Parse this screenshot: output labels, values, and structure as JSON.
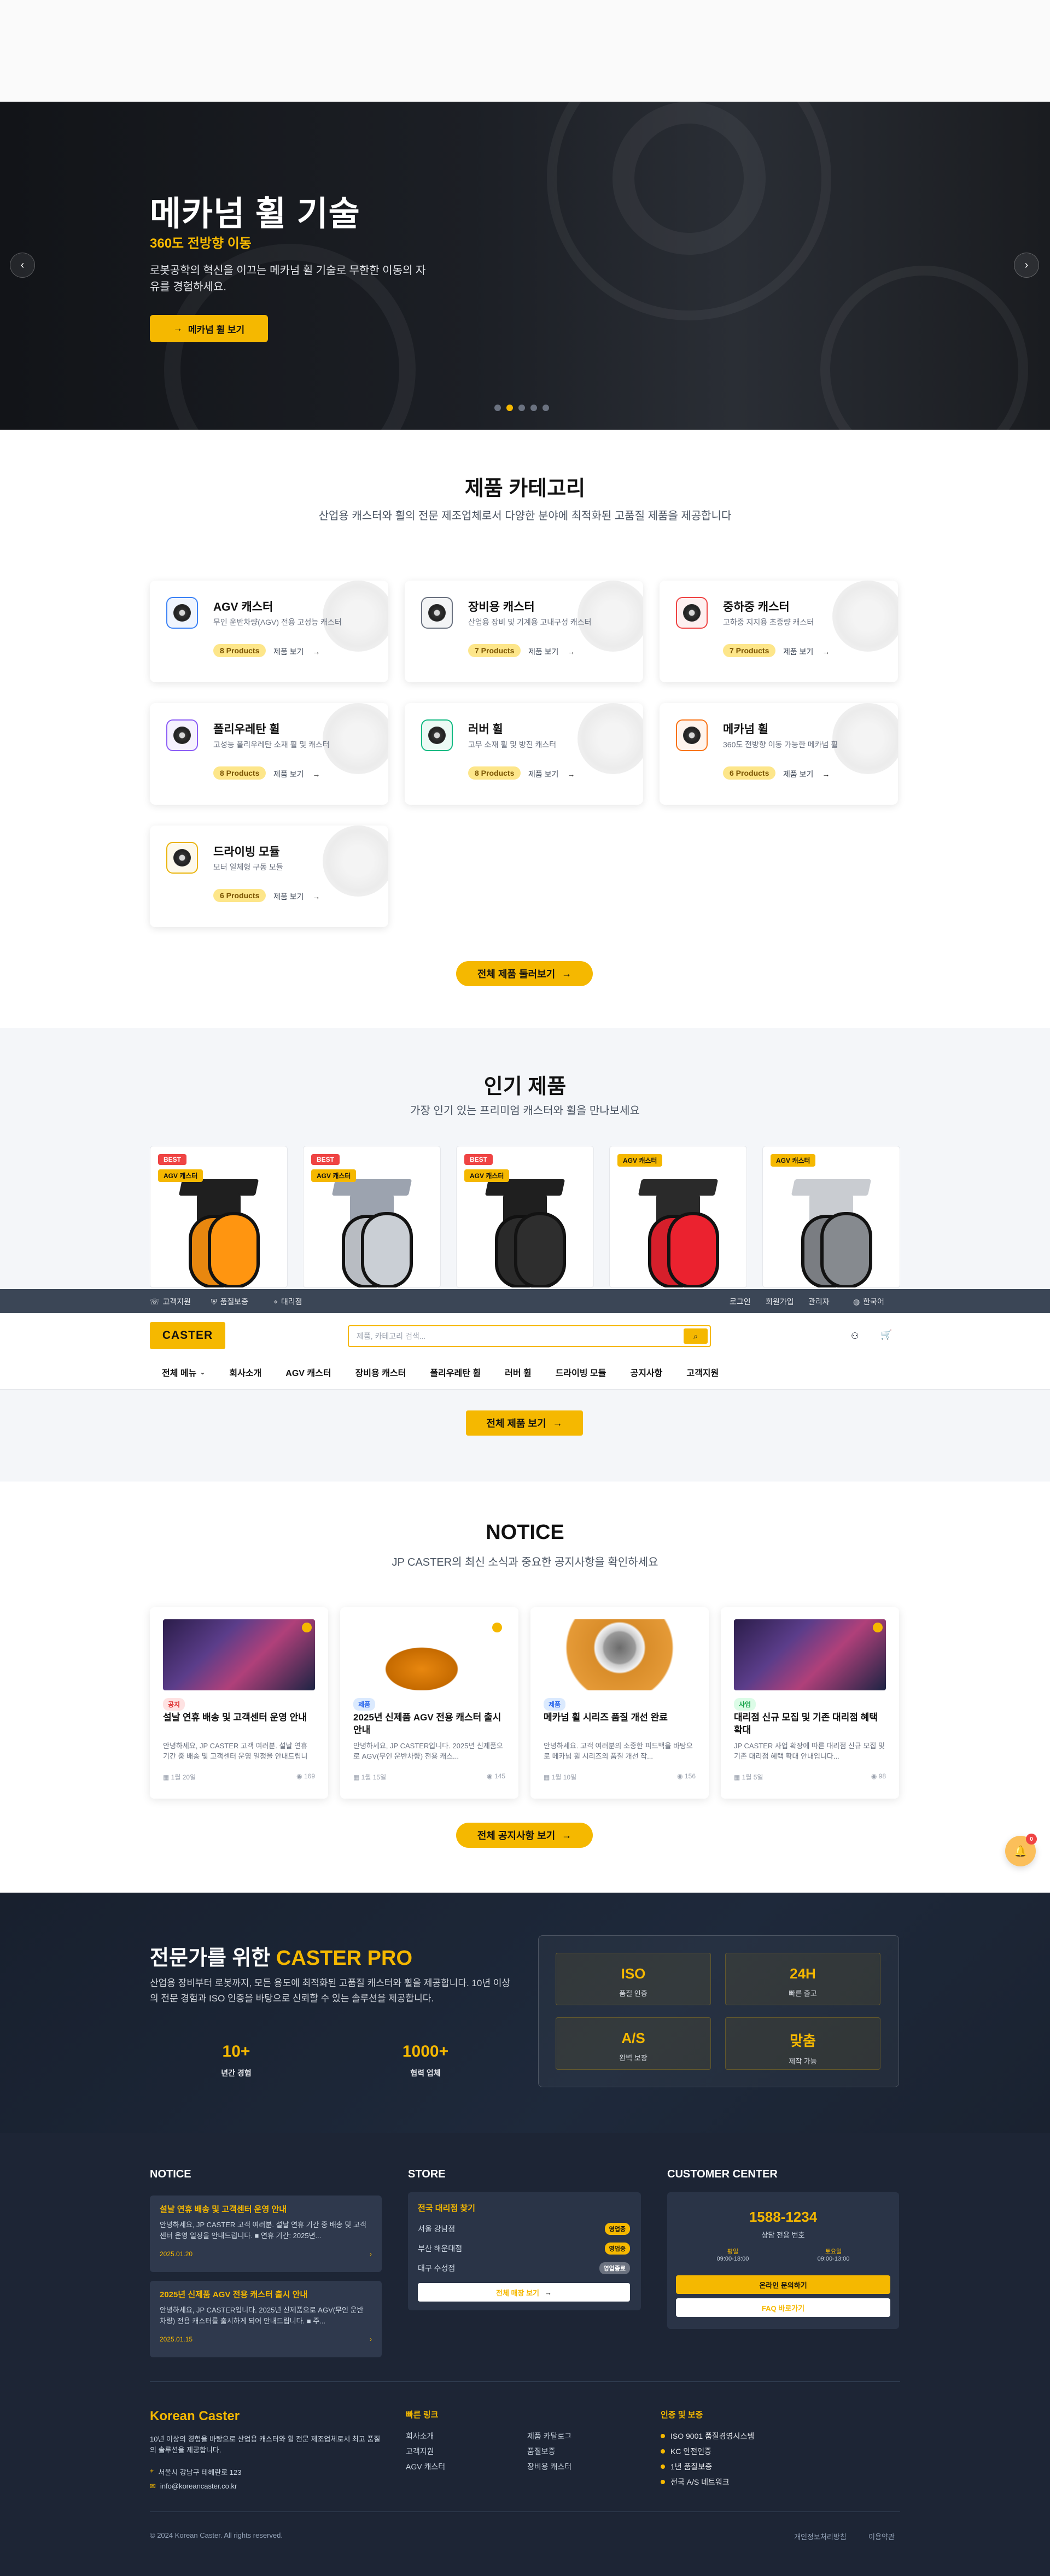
{
  "hero": {
    "title": "메카넘 휠 기술",
    "subtitle": "360도 전방향 이동",
    "desc": "로봇공학의 혁신을 이끄는 메카넘 휠 기술로 무한한 이동의 자유를 경험하세요.",
    "button": "메카넘 휠 보기",
    "prev_icon": "chevron-left-icon",
    "next_icon": "chevron-right-icon",
    "slides": 5,
    "active_slide": 2
  },
  "categories": {
    "title": "제품 카테고리",
    "desc": "산업용 캐스터와 휠의 전문 제조업체로서 다양한 분야에 최적화된 고품질 제품을 제공합니다",
    "items": [
      {
        "name": "AGV 캐스터",
        "desc": "무인 운반차량(AGV) 전용 고성능 캐스터",
        "count": "8 Products",
        "more": "제품 보기",
        "color": "#3b82f6"
      },
      {
        "name": "장비용 캐스터",
        "desc": "산업용 장비 및 기계용 고내구성 캐스터",
        "count": "7 Products",
        "more": "제품 보기",
        "color": "#6b7280"
      },
      {
        "name": "중하중 캐스터",
        "desc": "고하중 지지용 초중량 캐스터",
        "count": "7 Products",
        "more": "제품 보기",
        "color": "#ef4444"
      },
      {
        "name": "폴리우레탄 휠",
        "desc": "고성능 폴리우레탄 소재 휠 및 캐스터",
        "count": "8 Products",
        "more": "제품 보기",
        "color": "#8b5cf6"
      },
      {
        "name": "러버 휠",
        "desc": "고무 소재 휠 및 방진 캐스터",
        "count": "8 Products",
        "more": "제품 보기",
        "color": "#10b981"
      },
      {
        "name": "메카넘 휠",
        "desc": "360도 전방향 이동 가능한 메카넘 휠",
        "count": "6 Products",
        "more": "제품 보기",
        "color": "#f97316"
      },
      {
        "name": "드라이빙 모듈",
        "desc": "모터 일체형 구동 모듈",
        "count": "6 Products",
        "more": "제품 보기",
        "color": "#eab308"
      }
    ],
    "all_button": "전체 제품 둘러보기"
  },
  "popular": {
    "title": "인기 제품",
    "desc": "가장 인기 있는 프리미엄 캐스터와 휠을 만나보세요",
    "items": [
      {
        "best": "BEST",
        "cat": "AGV 캐스터",
        "wheel": "#e8870f",
        "top": "#1f1f1f"
      },
      {
        "best": "BEST",
        "cat": "AGV 캐스터",
        "wheel": "#b8bcc2",
        "top": "#9ca3af"
      },
      {
        "best": "BEST",
        "cat": "AGV 캐스터",
        "wheel": "#2a2a2a",
        "top": "#1f1f1f"
      },
      {
        "best": "",
        "cat": "AGV 캐스터",
        "wheel": "#d61f2b",
        "top": "#2a2a2a"
      },
      {
        "best": "",
        "cat": "AGV 캐스터",
        "wheel": "#7a7d82",
        "top": "#c9ccd1"
      }
    ],
    "all_button": "전체 제품 보기"
  },
  "util": {
    "left": [
      "고객지원",
      "품질보증",
      "대리점"
    ],
    "right": [
      "로그인",
      "회원가입",
      "관리자",
      "한국어"
    ]
  },
  "header": {
    "logo": "CASTER",
    "search_placeholder": "제품, 카테고리 검색...",
    "nav": [
      "전체 메뉴",
      "회사소개",
      "AGV 캐스터",
      "장비용 캐스터",
      "폴리우레탄 휠",
      "러버 휠",
      "드라이빙 모듈",
      "공지사항",
      "고객지원"
    ]
  },
  "notice": {
    "title": "NOTICE",
    "desc": "JP CASTER의 최신 소식과 중요한 공지사항을 확인하세요",
    "items": [
      {
        "tag": "공지",
        "tag_color": "#fee2e2",
        "tag_text": "#dc2626",
        "title": "설날 연휴 배송 및 고객센터 운영 안내",
        "body": "안녕하세요, JP CASTER 고객 여러분. 설날 연휴 기간 중 배송 및 고객센터 운영 일정을 안내드립니다.",
        "date": "1월 20일",
        "views": "169",
        "img": "photo"
      },
      {
        "tag": "제품",
        "tag_color": "#dbeafe",
        "tag_text": "#2563eb",
        "title": "2025년 신제품 AGV 전용 캐스터 출시 안내",
        "body": "안녕하세요, JP CASTER입니다. 2025년 신제품으로 AGV(무인 운반차량) 전용 캐스...",
        "date": "1월 15일",
        "views": "145",
        "img": "caster"
      },
      {
        "tag": "제품",
        "tag_color": "#dbeafe",
        "tag_text": "#2563eb",
        "title": "메카넘 휠 시리즈 품질 개선 완료",
        "body": "안녕하세요. 고객 여러분의 소중한 피드백을 바탕으로 메카넘 휠 시리즈의 품질 개선 작...",
        "date": "1월 10일",
        "views": "156",
        "img": "wheel"
      },
      {
        "tag": "사업",
        "tag_color": "#dcfce7",
        "tag_text": "#16a34a",
        "title": "대리점 신규 모집 및 기존 대리점 혜택 확대",
        "body": "JP CASTER 사업 확장에 따른 대리점 신규 모집 및 기존 대리점 혜택 확대 안내입니다...",
        "date": "1월 5일",
        "views": "98",
        "img": "photo"
      }
    ],
    "all_button": "전체 공지사항 보기",
    "floating_badge": "0"
  },
  "pro": {
    "title_a": "전문가를 위한 ",
    "title_b": "CASTER PRO",
    "desc": "산업용 장비부터 로봇까지, 모든 용도에 최적화된 고품질 캐스터와 휠을 제공합니다. 10년 이상의 전문 경험과 ISO 인증을 바탕으로 신뢰할 수 있는 솔루션을 제공합니다.",
    "stats": [
      {
        "v": "10+",
        "l": "년간 경험"
      },
      {
        "v": "1000+",
        "l": "협력 업체"
      }
    ],
    "cells": [
      {
        "v": "ISO",
        "l": "품질 인증"
      },
      {
        "v": "24H",
        "l": "빠른 출고"
      },
      {
        "v": "A/S",
        "l": "완벽 보장"
      },
      {
        "v": "맞춤",
        "l": "제작 가능"
      }
    ]
  },
  "footer": {
    "notice_title": "NOTICE",
    "notices": [
      {
        "t": "설날 연휴 배송 및 고객센터 운영 안내",
        "b": "안녕하세요, JP CASTER 고객 여러분. 설날 연휴 기간 중 배송 및 고객센터 운영 일정을 안내드립니다. ■ 연휴 기간: 2025년...",
        "d": "2025.01.20",
        "a": "›"
      },
      {
        "t": "2025년 신제품 AGV 전용 캐스터 출시 안내",
        "b": "안녕하세요, JP CASTER입니다. 2025년 신제품으로 AGV(무인 운반차량) 전용 캐스터를 출시하게 되어 안내드립니다. ■ 주...",
        "d": "2025.01.15",
        "a": "›"
      }
    ],
    "store_title": "STORE",
    "store_box_title": "전국 대리점 찾기",
    "stores": [
      {
        "n": "서울 강남점",
        "s": "영업중"
      },
      {
        "n": "부산 해운대점",
        "s": "영업중"
      },
      {
        "n": "대구 수성점",
        "s": "영업종료"
      }
    ],
    "store_btn": "전체 매장 보기",
    "cc_title": "CUSTOMER CENTER",
    "phone": "1588-1234",
    "phone_label": "상담 전용 번호",
    "hours": [
      {
        "l": "평일",
        "v": "09:00-18:00"
      },
      {
        "l": "토요일",
        "v": "09:00-13:00"
      }
    ],
    "cc_btn1": "온라인 문의하기",
    "cc_btn2": "FAQ 바로가기",
    "brand": "Korean Caster",
    "brand_desc": "10년 이상의 경험을 바탕으로 산업용 캐스터와 휠 전문 제조업체로서 최고 품질의 솔루션을 제공합니다.",
    "address": "서울시 강남구 테헤란로 123",
    "email": "info@koreancaster.co.kr",
    "links_title": "빠른 링크",
    "links": [
      "회사소개",
      "제품 카탈로그",
      "고객지원",
      "품질보증",
      "AGV 캐스터",
      "장비용 캐스터"
    ],
    "cert_title": "인증 및 보증",
    "certs": [
      "ISO 9001 품질경영시스템",
      "KC 안전인증",
      "1년 품질보증",
      "전국 A/S 네트워크"
    ],
    "copyright": "© 2024 Korean Caster. All rights reserved.",
    "privacy": "개인정보처리방침",
    "terms": "이용약관"
  }
}
